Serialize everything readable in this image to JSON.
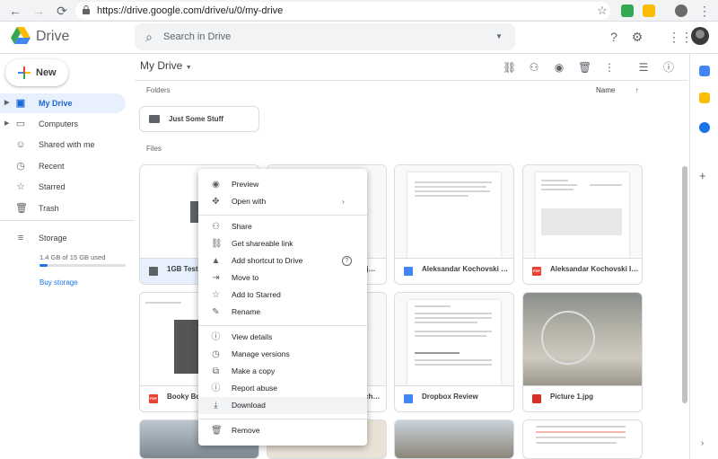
{
  "browser": {
    "url": "https://drive.google.com/drive/u/0/my-drive"
  },
  "header": {
    "app_name": "Drive",
    "search_placeholder": "Search in Drive"
  },
  "sidebar": {
    "new_label": "New",
    "items": [
      {
        "label": "My Drive",
        "icon": "my-drive-icon",
        "active": true
      },
      {
        "label": "Computers",
        "icon": "computer-icon"
      },
      {
        "label": "Shared with me",
        "icon": "people-icon"
      },
      {
        "label": "Recent",
        "icon": "clock-icon"
      },
      {
        "label": "Starred",
        "icon": "star-icon"
      },
      {
        "label": "Trash",
        "icon": "trash-icon"
      }
    ],
    "storage_label": "Storage",
    "storage_used": "1.4 GB of 15 GB used",
    "storage_fraction": 0.093,
    "buy_storage": "Buy storage"
  },
  "main": {
    "title": "My Drive",
    "folders_label": "Folders",
    "files_label": "Files",
    "sort_label": "Name",
    "folders": [
      {
        "name": "Just Some Stuff"
      }
    ],
    "files": [
      {
        "name": "1GB Test…",
        "type": "other"
      },
      {
        "name": "…lj…",
        "type": "doc"
      },
      {
        "name": "Aleksandar Kochovski Bio",
        "type": "doc"
      },
      {
        "name": "Aleksandar Kochovski In…",
        "type": "pdf"
      },
      {
        "name": "Booky Bo…",
        "type": "pdf"
      },
      {
        "name": "…ch…",
        "type": "doc"
      },
      {
        "name": "Dropbox Review",
        "type": "doc"
      },
      {
        "name": "Picture 1.jpg",
        "type": "img"
      }
    ]
  },
  "context_menu": {
    "items": [
      {
        "label": "Preview",
        "icon": "eye-icon"
      },
      {
        "label": "Open with",
        "icon": "move-arrows-icon",
        "submenu": true
      },
      {
        "label": "Share",
        "icon": "person-add-icon"
      },
      {
        "label": "Get shareable link",
        "icon": "link-icon"
      },
      {
        "label": "Add shortcut to Drive",
        "icon": "drive-shortcut-icon",
        "help": true
      },
      {
        "label": "Move to",
        "icon": "folder-move-icon"
      },
      {
        "label": "Add to Starred",
        "icon": "star-icon"
      },
      {
        "label": "Rename",
        "icon": "pencil-icon"
      },
      {
        "label": "View details",
        "icon": "info-icon"
      },
      {
        "label": "Manage versions",
        "icon": "history-icon"
      },
      {
        "label": "Make a copy",
        "icon": "copy-icon"
      },
      {
        "label": "Report abuse",
        "icon": "report-icon"
      },
      {
        "label": "Download",
        "icon": "download-icon",
        "hover": true
      },
      {
        "label": "Remove",
        "icon": "trash-icon"
      }
    ]
  },
  "colors": {
    "accent": "#1a73e8",
    "active_bg": "#e8f0fe",
    "pdf": "#ea4335",
    "doc": "#4285f4"
  }
}
